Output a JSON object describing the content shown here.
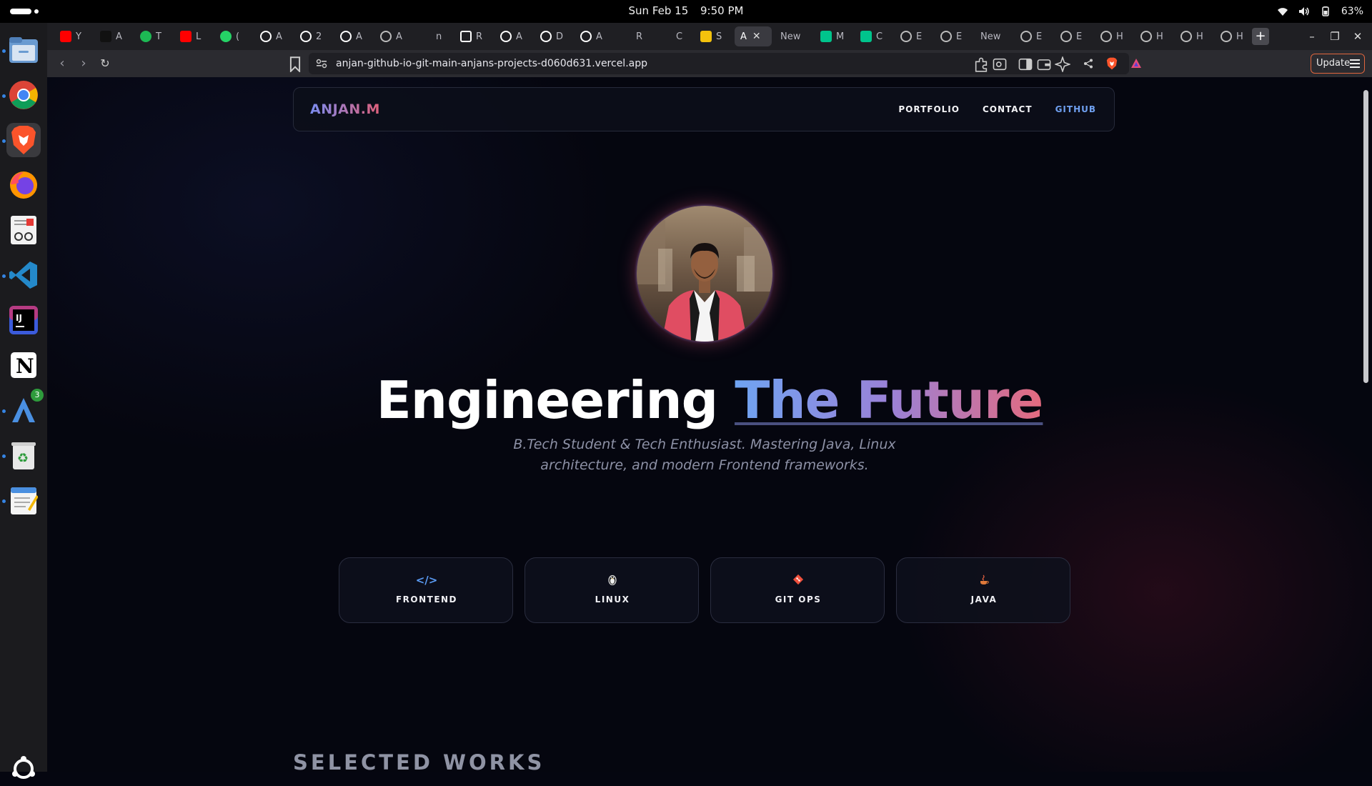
{
  "system": {
    "date": "Sun Feb 15",
    "time": "9:50 PM",
    "battery": "63%"
  },
  "dock": {
    "items": [
      "files-icon",
      "chrome-icon",
      "brave-icon",
      "firefox-icon",
      "reader-icon",
      "vscode-icon",
      "intellij-icon",
      "notion-icon",
      "arch-app-icon",
      "trash-icon",
      "text-editor-icon"
    ],
    "badge": "3"
  },
  "browser": {
    "tabs": [
      {
        "fav": "youtube",
        "label": "Y",
        "color": "#ff0000"
      },
      {
        "fav": "cc",
        "label": "A",
        "color": "#111111"
      },
      {
        "fav": "spotify",
        "label": "T",
        "color": "#1db954"
      },
      {
        "fav": "youtube",
        "label": "L",
        "color": "#ff0000"
      },
      {
        "fav": "whatsapp",
        "label": "(",
        "color": "#25d366"
      },
      {
        "fav": "github",
        "label": "A",
        "color": "#ffffff"
      },
      {
        "fav": "github",
        "label": "2",
        "color": "#ffffff"
      },
      {
        "fav": "wm",
        "label": "A",
        "color": "#ffffff"
      },
      {
        "fav": "globe",
        "label": "A",
        "color": "#bbbbbb"
      },
      {
        "fav": "delta",
        "label": "n",
        "color": "#ffffff"
      },
      {
        "fav": "target",
        "label": "R",
        "color": "#ffffff"
      },
      {
        "fav": "github",
        "label": "A",
        "color": "#ffffff"
      },
      {
        "fav": "wm",
        "label": "D",
        "color": "#ffffff"
      },
      {
        "fav": "github",
        "label": "A",
        "color": "#ffffff"
      },
      {
        "fav": "link",
        "label": "R",
        "color": "#ffffff"
      },
      {
        "fav": "link",
        "label": "C",
        "color": "#ffffff"
      },
      {
        "fav": "sheet",
        "label": "S",
        "color": "#f4c20d"
      },
      {
        "fav": "active",
        "label": "A",
        "color": "#ffffff"
      },
      {
        "fav": "none",
        "label": "New",
        "color": "#777777"
      },
      {
        "fav": "leaf",
        "label": "M",
        "color": "#00c48c"
      },
      {
        "fav": "leaf",
        "label": "C",
        "color": "#00c48c"
      },
      {
        "fav": "globe",
        "label": "E",
        "color": "#bbbbbb"
      },
      {
        "fav": "globe",
        "label": "E",
        "color": "#bbbbbb"
      },
      {
        "fav": "none",
        "label": "New",
        "color": "#777777"
      },
      {
        "fav": "globe",
        "label": "E",
        "color": "#bbbbbb"
      },
      {
        "fav": "globe",
        "label": "E",
        "color": "#bbbbbb"
      },
      {
        "fav": "globe",
        "label": "H",
        "color": "#bbbbbb"
      },
      {
        "fav": "globe",
        "label": "H",
        "color": "#bbbbbb"
      },
      {
        "fav": "globe",
        "label": "H",
        "color": "#bbbbbb"
      },
      {
        "fav": "globe",
        "label": "H",
        "color": "#bbbbbb"
      }
    ],
    "url": "anjan-github-io-git-main-anjans-projects-d060d631.vercel.app",
    "update_label": "Update"
  },
  "page": {
    "brand": "ANJAN.M",
    "nav": [
      "PORTFOLIO",
      "CONTACT",
      "GITHUB"
    ],
    "hero_title_main": "Engineering ",
    "hero_title_accent": "The Future",
    "hero_subtitle": "B.Tech Student & Tech Enthusiast. Mastering Java, Linux architecture, and modern Frontend frameworks.",
    "skills": [
      {
        "label": "FRONTEND",
        "icon": "code-icon",
        "glyph": "</>",
        "color": "#5b9cf5"
      },
      {
        "label": "LINUX",
        "icon": "tux-icon",
        "glyph": "🐧",
        "color": "#dddddd"
      },
      {
        "label": "GIT OPS",
        "icon": "git-icon",
        "glyph": "◆",
        "color": "#f0503c"
      },
      {
        "label": "JAVA",
        "icon": "java-icon",
        "glyph": "☕",
        "color": "#e07a3a"
      }
    ],
    "section_title": "SELECTED WORKS"
  },
  "colors": {
    "accent_blue": "#6fa0f0",
    "accent_pink": "#e0607a",
    "background": "#05060f"
  }
}
